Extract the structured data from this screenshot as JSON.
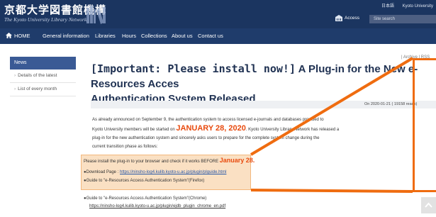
{
  "header": {
    "logo_ja": "京都大学図書館機構",
    "logo_en": "The Kyoto University Library Network",
    "lang_link": "日本語",
    "univ_link": "Kyoto University",
    "access": "Access",
    "search_placeholder": "Site search"
  },
  "nav": [
    {
      "label": "HOME",
      "icon": "home-icon"
    },
    {
      "label": "General information"
    },
    {
      "label": "Libraries"
    },
    {
      "label": "Hours"
    },
    {
      "label": "Collections"
    },
    {
      "label": "About us"
    },
    {
      "label": "Contact us"
    }
  ],
  "sidebar": {
    "heading": "News",
    "items": [
      "Details of the latest",
      "List of every month"
    ]
  },
  "article": {
    "archive_link": "| Archive | RSS",
    "title_bracket": "[Important: Please install now!]",
    "title_line1_rest": " A Plug-in for the New e-Resources Acces",
    "title_line2": "Authentication System Released",
    "meta": "On 2020-01-21 ( 19158 reads)",
    "p1_a": "As already announced on September 9, the authentication system to access licensed e-journals and databases provided to",
    "p1_b_pre": "Kyoto University members will be started on ",
    "p1_date": "JANUARY 28, 2020",
    "p1_b_post": ". Kyoto University Library Network has released a",
    "p1_c": "plug-in for the new authentication system and sincerely asks users to prepare for the complete system change during the",
    "p1_d": "current transition phase as follows:",
    "notice_pre": "Please install the plug-in to your browser and check if it works BEFORE ",
    "notice_date": "January 28",
    "notice_post": ".",
    "download_label": "●Download Page : ",
    "download_url": "https://ninsho-log4.kulib.kyoto-u.ac.jp/plugin/plguide.html",
    "guide_firefox": "●Guide to \"e-Resources Access Authentication System\"(Firefox)",
    "guide_chrome": "●Guide to \"e-Resources Access Authentication System\"(Chrome)",
    "guide_chrome_url": "https://ninsho-log4.kulib.kyoto-u.ac.jp/plugin/ejdb_plugin_chrome_en.pdf"
  },
  "colors": {
    "header_bg": "#1b3560",
    "nav_bg": "#1f3c6b",
    "news_head": "#3a5a95",
    "accent_orange": "#e84a0e",
    "zoom_outline": "#ef6c10"
  }
}
